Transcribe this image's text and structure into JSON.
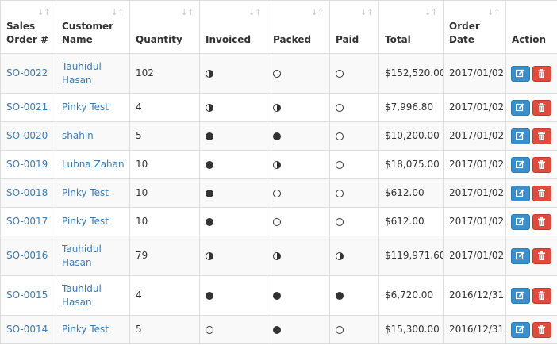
{
  "columns": [
    {
      "key": "so",
      "label": "Sales Order #"
    },
    {
      "key": "customer",
      "label": "Customer Name"
    },
    {
      "key": "qty",
      "label": "Quantity"
    },
    {
      "key": "invoiced",
      "label": "Invoiced"
    },
    {
      "key": "packed",
      "label": "Packed"
    },
    {
      "key": "paid",
      "label": "Paid"
    },
    {
      "key": "total",
      "label": "Total"
    },
    {
      "key": "date",
      "label": "Order Date"
    },
    {
      "key": "action",
      "label": "Action"
    }
  ],
  "sort_glyph": "↓↑",
  "rows": [
    {
      "so": "SO-0022",
      "customer": "Tauhidul Hasan",
      "qty": "102",
      "invoiced": "half",
      "packed": "empty",
      "paid": "empty",
      "total": "$152,520.00",
      "date": "2017/01/02"
    },
    {
      "so": "SO-0021",
      "customer": "Pinky Test",
      "qty": "4",
      "invoiced": "half",
      "packed": "half",
      "paid": "empty",
      "total": "$7,996.80",
      "date": "2017/01/02"
    },
    {
      "so": "SO-0020",
      "customer": "shahin",
      "qty": "5",
      "invoiced": "full",
      "packed": "full",
      "paid": "empty",
      "total": "$10,200.00",
      "date": "2017/01/02"
    },
    {
      "so": "SO-0019",
      "customer": "Lubna Zahan",
      "qty": "10",
      "invoiced": "full",
      "packed": "half",
      "paid": "empty",
      "total": "$18,075.00",
      "date": "2017/01/02"
    },
    {
      "so": "SO-0018",
      "customer": "Pinky Test",
      "qty": "10",
      "invoiced": "full",
      "packed": "empty",
      "paid": "empty",
      "total": "$612.00",
      "date": "2017/01/02"
    },
    {
      "so": "SO-0017",
      "customer": "Pinky Test",
      "qty": "10",
      "invoiced": "full",
      "packed": "empty",
      "paid": "empty",
      "total": "$612.00",
      "date": "2017/01/02"
    },
    {
      "so": "SO-0016",
      "customer": "Tauhidul Hasan",
      "qty": "79",
      "invoiced": "half",
      "packed": "half",
      "paid": "half",
      "total": "$119,971.60",
      "date": "2017/01/02"
    },
    {
      "so": "SO-0015",
      "customer": "Tauhidul Hasan",
      "qty": "4",
      "invoiced": "full",
      "packed": "full",
      "paid": "full",
      "total": "$6,720.00",
      "date": "2016/12/31"
    },
    {
      "so": "SO-0014",
      "customer": "Pinky Test",
      "qty": "5",
      "invoiced": "empty",
      "packed": "full",
      "paid": "empty",
      "total": "$15,300.00",
      "date": "2016/12/31"
    }
  ],
  "icons": {
    "edit": "edit-icon",
    "delete": "trash-icon"
  },
  "colors": {
    "link": "#3a7cb8",
    "edit_button": "#3a8ec9",
    "delete_button": "#e14b3f",
    "stripe": "#f9f9f9"
  }
}
